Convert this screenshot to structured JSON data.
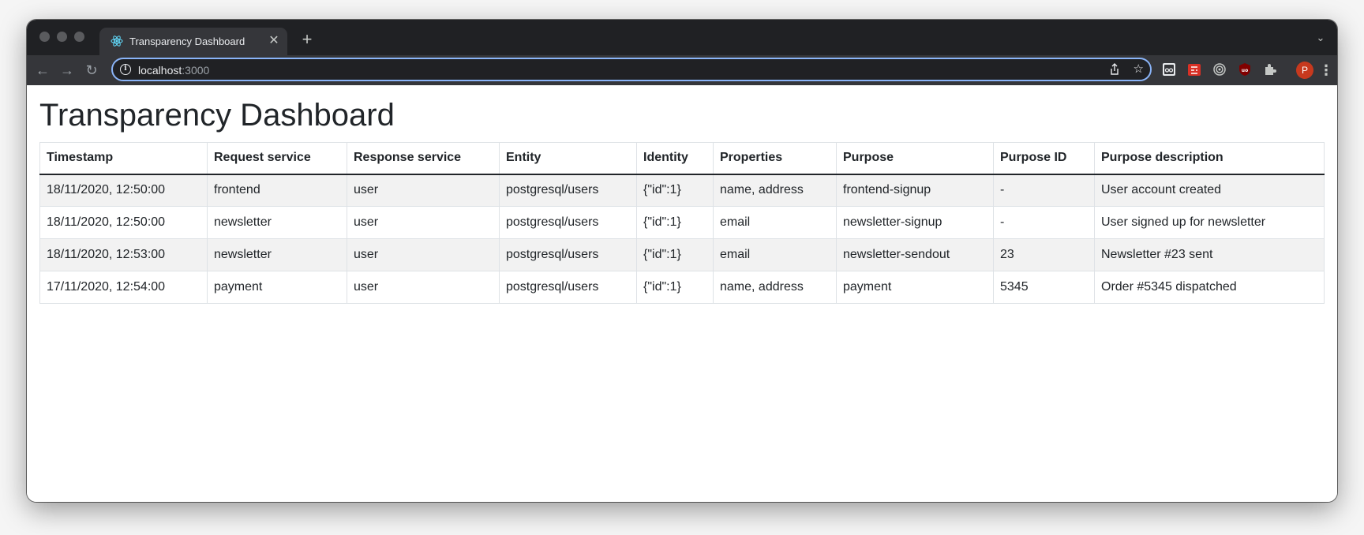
{
  "browser": {
    "tab_title": "Transparency Dashboard",
    "url_host": "localhost",
    "url_port": ":3000",
    "profile_initial": "P",
    "extensions": [
      "ext-eyes-icon",
      "ext-puzzle-red-icon",
      "ext-target-icon",
      "ext-ublock-icon",
      "extensions-puzzle-icon"
    ]
  },
  "page": {
    "title": "Transparency Dashboard"
  },
  "table": {
    "headers": [
      "Timestamp",
      "Request service",
      "Response service",
      "Entity",
      "Identity",
      "Properties",
      "Purpose",
      "Purpose ID",
      "Purpose description"
    ],
    "rows": [
      [
        "18/11/2020, 12:50:00",
        "frontend",
        "user",
        "postgresql/users",
        "{\"id\":1}",
        "name, address",
        "frontend-signup",
        "-",
        "User account created"
      ],
      [
        "18/11/2020, 12:50:00",
        "newsletter",
        "user",
        "postgresql/users",
        "{\"id\":1}",
        "email",
        "newsletter-signup",
        "-",
        "User signed up for newsletter"
      ],
      [
        "18/11/2020, 12:53:00",
        "newsletter",
        "user",
        "postgresql/users",
        "{\"id\":1}",
        "email",
        "newsletter-sendout",
        "23",
        "Newsletter #23 sent"
      ],
      [
        "17/11/2020, 12:54:00",
        "payment",
        "user",
        "postgresql/users",
        "{\"id\":1}",
        "name, address",
        "payment",
        "5345",
        "Order #5345 dispatched"
      ]
    ]
  }
}
